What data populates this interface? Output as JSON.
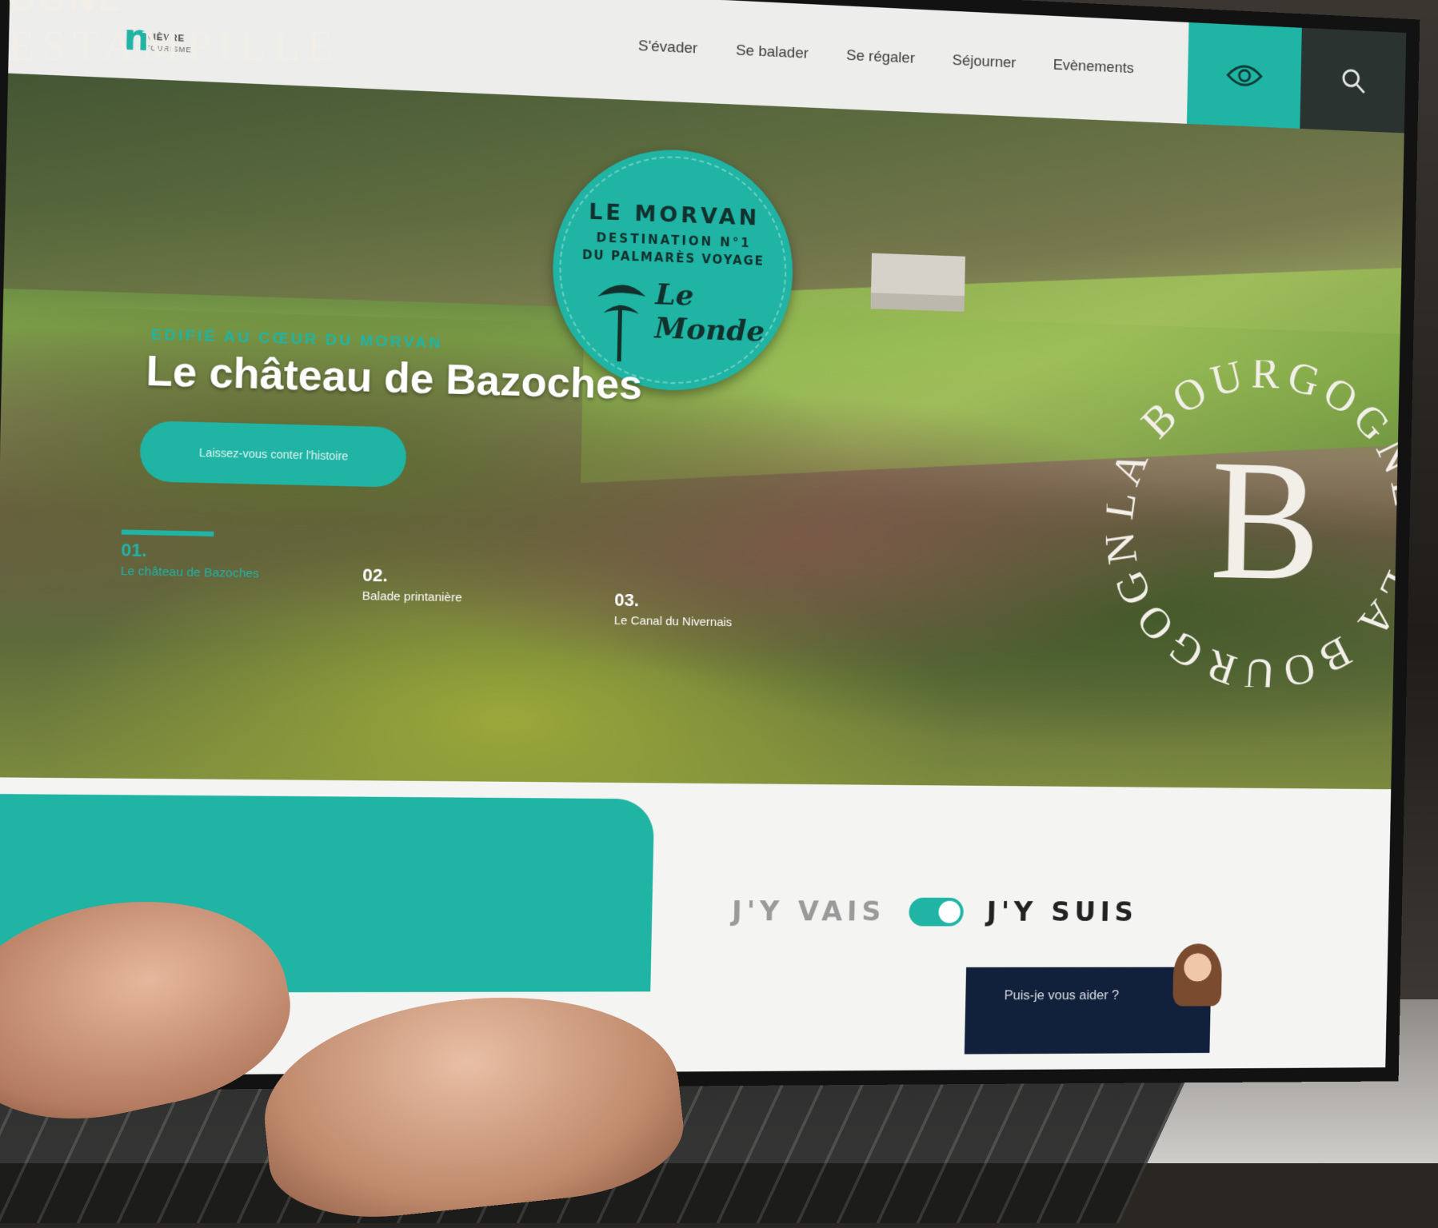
{
  "overlay": {
    "line1": "OGNE",
    "line2": "ESTAMPILLE"
  },
  "site": {
    "logo_line1": "NIÈVRE",
    "logo_line2": "TOURISME"
  },
  "nav": {
    "items": [
      {
        "label": "S'évader"
      },
      {
        "label": "Se balader"
      },
      {
        "label": "Se régaler"
      },
      {
        "label": "Séjourner"
      },
      {
        "label": "Evènements"
      }
    ],
    "accessibility_icon": "accessibility-icon",
    "search_icon": "search-icon"
  },
  "hero": {
    "kicker": "EDIFIÉ AU CŒUR DU MORVAN",
    "title": "Le château de Bazoches",
    "cta": "Laissez-vous conter l'histoire",
    "badge": {
      "line1": "LE MORVAN",
      "line2": "DESTINATION N°1",
      "line3": "DU PALMARÈS VOYAGE",
      "brand": "Le Monde"
    },
    "slides": [
      {
        "num": "01.",
        "label": "Le château de Bazoches",
        "active": true
      },
      {
        "num": "02.",
        "label": "Balade printanière",
        "active": false
      },
      {
        "num": "03.",
        "label": "Le Canal du Nivernais",
        "active": false
      }
    ],
    "ring_text": "LA BOURGOGNE · LA BOURGOGNE ·",
    "ring_letter": "B",
    "scroll_icon": "arrow-down-icon"
  },
  "switcher": {
    "left_label": "J'Y VAIS",
    "right_label": "J'Y SUIS",
    "state": "on"
  },
  "chat": {
    "prompt": "Puis-je vous aider ?"
  },
  "colors": {
    "accent": "#1fb4a4",
    "dark": "#2b3331",
    "chat_bg": "#12213b"
  }
}
